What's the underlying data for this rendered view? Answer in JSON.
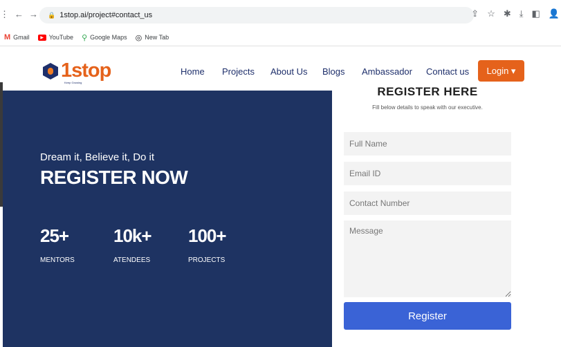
{
  "browser": {
    "url": "1stop.ai/project#contact_us",
    "nav_icons": [
      "menu-dots-icon",
      "back-icon",
      "forward-icon",
      "reload-icon"
    ],
    "toolbar_icons": [
      "share-icon",
      "star-icon",
      "extensions-icon",
      "download-icon",
      "sidebar-icon",
      "profile-icon"
    ],
    "bookmarks": [
      {
        "label": "Gmail",
        "icon": "gmail-icon"
      },
      {
        "label": "YouTube",
        "icon": "youtube-icon"
      },
      {
        "label": "Google Maps",
        "icon": "maps-icon"
      },
      {
        "label": "New Tab",
        "icon": "globe-icon"
      }
    ]
  },
  "site": {
    "logo_text": "1stop",
    "logo_tagline": "Keep Growing",
    "brand_color": "#e5621b",
    "nav": [
      "Home",
      "Projects",
      "About Us",
      "Blogs",
      "Ambassador",
      "Contact us"
    ],
    "login_label": "Login ▾"
  },
  "hero": {
    "tagline": "Dream it, Believe it, Do it",
    "headline": "REGISTER NOW",
    "background_color": "#1e3362",
    "stats": [
      {
        "value": "25+",
        "label": "MENTORS"
      },
      {
        "value": "10k+",
        "label": "ATENDEES"
      },
      {
        "value": "100+",
        "label": "PROJECTS"
      }
    ]
  },
  "form": {
    "title": "REGISTER HERE",
    "subtitle": "Fill below details to speak with our executive.",
    "full_name_placeholder": "Full Name",
    "email_placeholder": "Email ID",
    "contact_placeholder": "Contact Number",
    "message_placeholder": "Message",
    "submit_label": "Register",
    "submit_color": "#3a63d6"
  }
}
